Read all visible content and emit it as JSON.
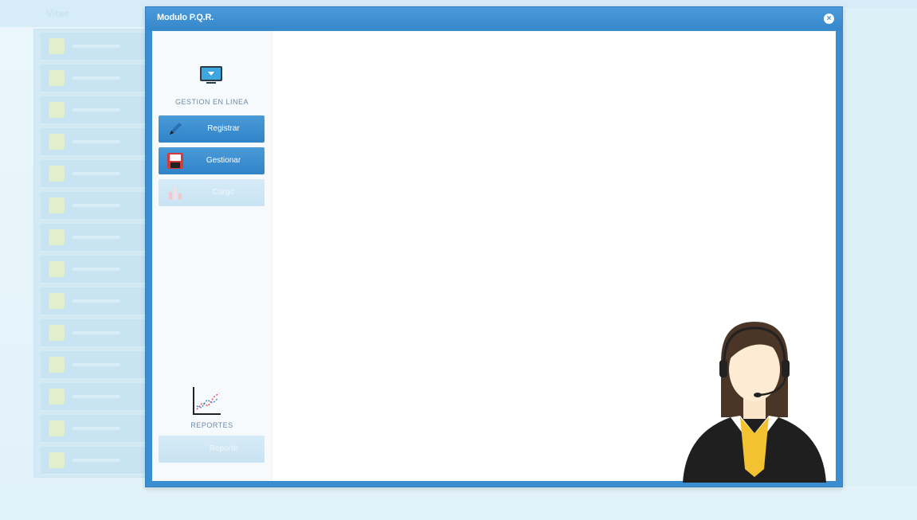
{
  "background": {
    "title": "Vitae",
    "sidebar_count": 14
  },
  "modal": {
    "title": "Modulo P.Q.R.",
    "close_label": "×"
  },
  "left_panel": {
    "online_label": "GESTION EN LINEA",
    "buttons": [
      {
        "label": "Registrar",
        "icon": "pencil-icon",
        "state": "active"
      },
      {
        "label": "Gestionar",
        "icon": "floppy-disk-icon",
        "state": "active"
      },
      {
        "label": "Cargo",
        "icon": "chart-bars-icon",
        "state": "disabled"
      }
    ],
    "reports_label": "REPORTES",
    "report_button": {
      "label": "Reporte",
      "state": "disabled"
    }
  },
  "colors": {
    "accent": "#3a8ed0",
    "button": "#2f83c8",
    "background": "#e2f2f9"
  }
}
